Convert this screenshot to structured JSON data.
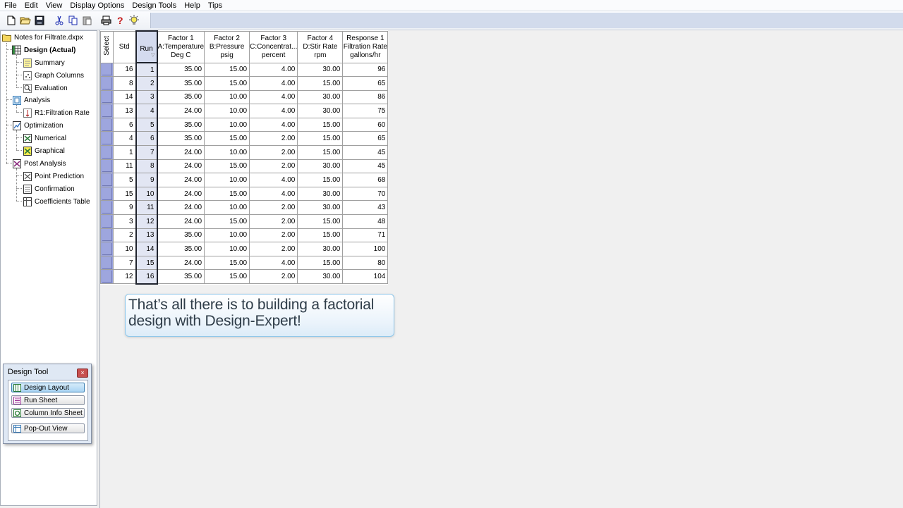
{
  "menu": [
    "File",
    "Edit",
    "View",
    "Display Options",
    "Design Tools",
    "Help",
    "Tips"
  ],
  "toolbar_icons": [
    "new-file-icon",
    "open-folder-icon",
    "save-icon",
    "cut-icon",
    "copy-icon",
    "paste-icon",
    "print-icon",
    "help-icon",
    "tip-bulb-icon"
  ],
  "tree": {
    "root": "Notes for Filtrate.dxpx",
    "design": "Design (Actual)",
    "summary": "Summary",
    "graph_columns": "Graph Columns",
    "evaluation": "Evaluation",
    "analysis": "Analysis",
    "r1": "R1:Filtration Rate",
    "optimization": "Optimization",
    "numerical": "Numerical",
    "graphical": "Graphical",
    "post_analysis": "Post Analysis",
    "point_prediction": "Point Prediction",
    "confirmation": "Confirmation",
    "coefficients_table": "Coefficients Table"
  },
  "grid": {
    "headers": {
      "select": "Select",
      "std": "Std",
      "run": "Run",
      "f1": [
        "Factor 1",
        "A:Temperature",
        "Deg C"
      ],
      "f2": [
        "Factor 2",
        "B:Pressure",
        "psig"
      ],
      "f3": [
        "Factor 3",
        "C:Concentrat...",
        "percent"
      ],
      "f4": [
        "Factor 4",
        "D:Stir Rate",
        "rpm"
      ],
      "r1": [
        "Response 1",
        "Filtration Rate",
        "gallons/hr"
      ]
    },
    "rows": [
      [
        "16",
        "1",
        "35.00",
        "15.00",
        "4.00",
        "30.00",
        "96"
      ],
      [
        "8",
        "2",
        "35.00",
        "15.00",
        "4.00",
        "15.00",
        "65"
      ],
      [
        "14",
        "3",
        "35.00",
        "10.00",
        "4.00",
        "30.00",
        "86"
      ],
      [
        "13",
        "4",
        "24.00",
        "10.00",
        "4.00",
        "30.00",
        "75"
      ],
      [
        "6",
        "5",
        "35.00",
        "10.00",
        "4.00",
        "15.00",
        "60"
      ],
      [
        "4",
        "6",
        "35.00",
        "15.00",
        "2.00",
        "15.00",
        "65"
      ],
      [
        "1",
        "7",
        "24.00",
        "10.00",
        "2.00",
        "15.00",
        "45"
      ],
      [
        "11",
        "8",
        "24.00",
        "15.00",
        "2.00",
        "30.00",
        "45"
      ],
      [
        "5",
        "9",
        "24.00",
        "10.00",
        "4.00",
        "15.00",
        "68"
      ],
      [
        "15",
        "10",
        "24.00",
        "15.00",
        "4.00",
        "30.00",
        "70"
      ],
      [
        "9",
        "11",
        "24.00",
        "10.00",
        "2.00",
        "30.00",
        "43"
      ],
      [
        "3",
        "12",
        "24.00",
        "15.00",
        "2.00",
        "15.00",
        "48"
      ],
      [
        "2",
        "13",
        "35.00",
        "10.00",
        "2.00",
        "15.00",
        "71"
      ],
      [
        "10",
        "14",
        "35.00",
        "10.00",
        "2.00",
        "30.00",
        "100"
      ],
      [
        "7",
        "15",
        "24.00",
        "15.00",
        "4.00",
        "15.00",
        "80"
      ],
      [
        "12",
        "16",
        "35.00",
        "15.00",
        "2.00",
        "30.00",
        "104"
      ]
    ]
  },
  "callout": {
    "line1": "That’s all there is to building a factorial",
    "line2": "design with Design-Expert!"
  },
  "design_tool": {
    "title": "Design Tool",
    "close": "×",
    "buttons": [
      "Design Layout",
      "Run Sheet",
      "Column Info Sheet",
      "Pop-Out View"
    ]
  }
}
